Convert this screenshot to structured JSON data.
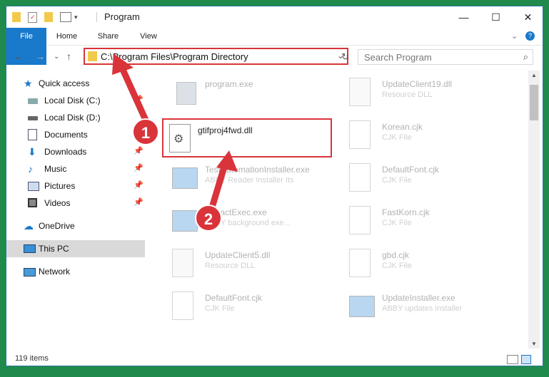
{
  "window": {
    "title": "Program"
  },
  "titlebar": {
    "minimize": "—",
    "maximize": "☐",
    "close": "✕"
  },
  "ribbon": {
    "tabs": [
      "File",
      "Home",
      "Share",
      "View"
    ]
  },
  "address": {
    "path": "C:\\Program Files\\Program Directory"
  },
  "search": {
    "placeholder": "Search Program"
  },
  "nav": {
    "items": [
      {
        "label": "Quick access"
      },
      {
        "label": "Local Disk (C:)"
      },
      {
        "label": "Local Disk (D:)"
      },
      {
        "label": "Documents"
      },
      {
        "label": "Downloads"
      },
      {
        "label": "Music"
      },
      {
        "label": "Pictures"
      },
      {
        "label": "Videos"
      },
      {
        "label": "OneDrive"
      },
      {
        "label": "This PC"
      },
      {
        "label": "Network"
      }
    ]
  },
  "files": [
    {
      "name": "program.exe",
      "type": ""
    },
    {
      "name": "UpdateClient19.dll",
      "type": "Resource DLL"
    },
    {
      "name": "gtifproj4fwd.dll",
      "type": ""
    },
    {
      "name": "Korean.cjk",
      "type": "CJK File"
    },
    {
      "name": "TestAutomationInstaller.exe",
      "type": "ABBY Reader Installer Its"
    },
    {
      "name": "DefaultFont.cjk",
      "type": "CJK File"
    },
    {
      "name": "ExtractExec.exe",
      "type": "ABBY background exe..."
    },
    {
      "name": "FastKorn.cjk",
      "type": "CJK File"
    },
    {
      "name": "UpdateClient5.dll",
      "type": "Resource DLL"
    },
    {
      "name": "gbd.cjk",
      "type": "CJK File"
    },
    {
      "name": "DefaultFont.cjk",
      "type": "CJK File"
    },
    {
      "name": "UpdateInstaller.exe",
      "type": "ABBY updates installer"
    }
  ],
  "status": {
    "count": "119 items"
  },
  "annotations": {
    "badge1": "1",
    "badge2": "2"
  },
  "colors": {
    "accent": "#1979ca",
    "highlight": "#d9343a",
    "desktop": "#1f8a4c"
  }
}
